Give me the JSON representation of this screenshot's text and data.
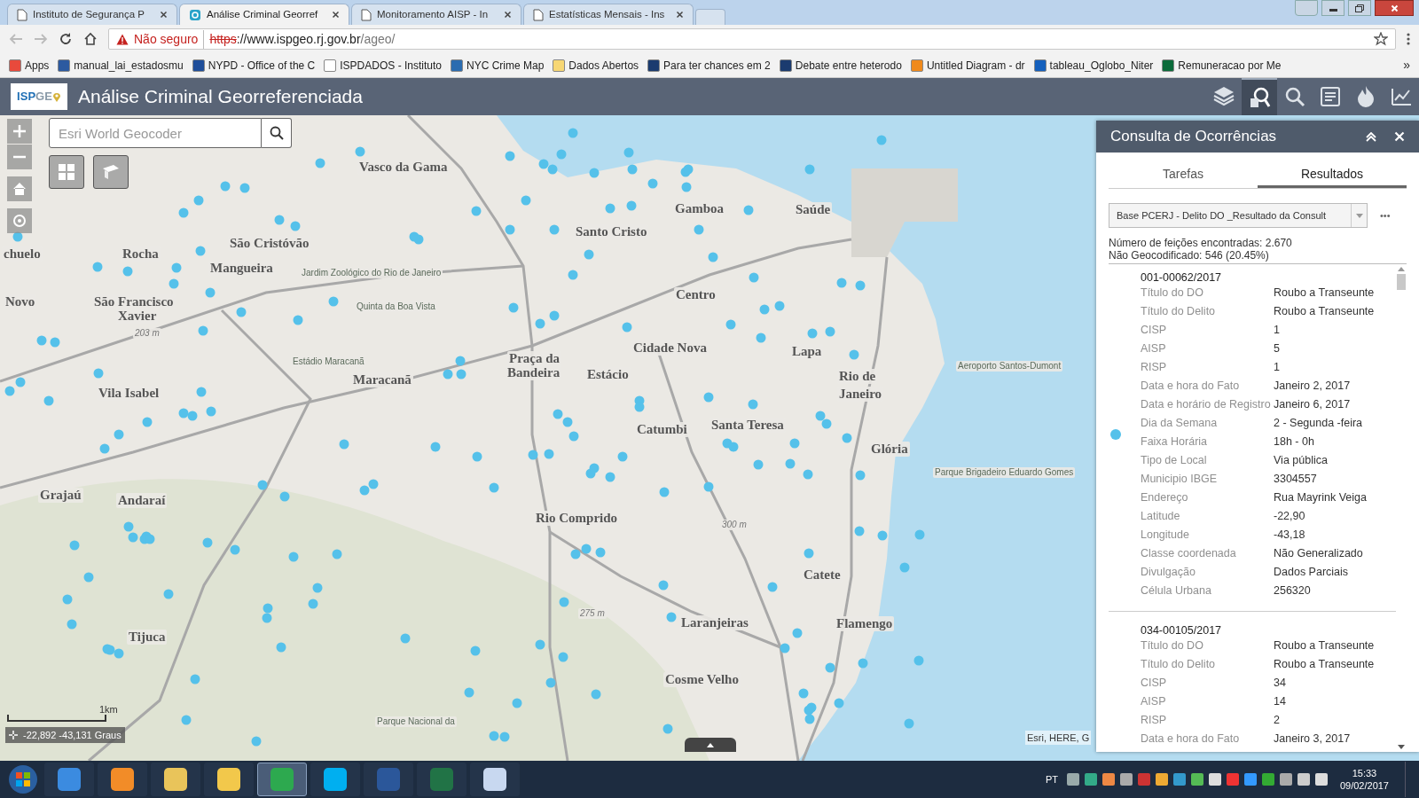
{
  "browser": {
    "tabs": [
      {
        "label": "Instituto de Segurança P",
        "selected": false
      },
      {
        "label": "Análise Criminal Georref",
        "selected": true
      },
      {
        "label": "Monitoramento AISP - In",
        "selected": false
      },
      {
        "label": "Estatísticas Mensais - Ins",
        "selected": false
      }
    ],
    "address": {
      "security": "Não seguro",
      "scheme": "https",
      "host": "://www.ispgeo.rj.gov.br",
      "path": "/ageo/"
    },
    "bookmarks": [
      "Apps",
      "manual_lai_estadosmu",
      "NYPD - Office of the C",
      "ISPDADOS - Instituto",
      "NYC Crime Map",
      "Dados Abertos",
      "Para ter chances em 2",
      "Debate entre heterodo",
      "Untitled Diagram - dr",
      "tableau_Oglobo_Niter",
      "Remuneracao por Me"
    ],
    "overflow": "»"
  },
  "app": {
    "logo": [
      "ISP",
      "GE"
    ],
    "title": "Análise Criminal Georreferenciada",
    "tools": [
      {
        "kind": "layers",
        "selected": false
      },
      {
        "kind": "query",
        "selected": true
      },
      {
        "kind": "search",
        "selected": false
      },
      {
        "kind": "list",
        "selected": false
      },
      {
        "kind": "fire",
        "selected": false
      },
      {
        "kind": "chart",
        "selected": false
      }
    ]
  },
  "map": {
    "search": {
      "placeholder": "Esri World Geocoder"
    },
    "labels": [
      {
        "kind": "district",
        "text": "Vasco da Gama"
      },
      {
        "kind": "district",
        "text": "Gamboa"
      },
      {
        "kind": "district",
        "text": "Saúde"
      },
      {
        "kind": "district",
        "text": "Santo Cristo"
      },
      {
        "kind": "district",
        "text": "São Cristóvão"
      },
      {
        "kind": "district",
        "text": "Rocha"
      },
      {
        "kind": "district",
        "text": "chuelo"
      },
      {
        "kind": "district",
        "text": "Mangueira"
      },
      {
        "kind": "poi",
        "text": "Jardim Zoológico do Rio de Janeiro"
      },
      {
        "kind": "district",
        "text": "Centro"
      },
      {
        "kind": "district",
        "text": "Novo"
      },
      {
        "kind": "district",
        "text": "São Francisco"
      },
      {
        "kind": "poi",
        "text": "Quinta da Boa Vista"
      },
      {
        "kind": "district",
        "text": "Xavier"
      },
      {
        "kind": "elevation",
        "text": "203 m"
      },
      {
        "kind": "district",
        "text": "Cidade Nova"
      },
      {
        "kind": "district",
        "text": "Lapa"
      },
      {
        "kind": "poi",
        "text": "Estádio Maracanã"
      },
      {
        "kind": "district",
        "text": "Praça da"
      },
      {
        "kind": "poi",
        "text": "Aeroporto Santos-Dumont"
      },
      {
        "kind": "district",
        "text": "Bandeira"
      },
      {
        "kind": "district",
        "text": "Estácio"
      },
      {
        "kind": "district",
        "text": "Rio de"
      },
      {
        "kind": "district",
        "text": "Maracanã"
      },
      {
        "kind": "district",
        "text": "Vila Isabel"
      },
      {
        "kind": "district",
        "text": "Janeiro"
      },
      {
        "kind": "district",
        "text": "Santa Teresa"
      },
      {
        "kind": "district",
        "text": "Catumbi"
      },
      {
        "kind": "district",
        "text": "Glória"
      },
      {
        "kind": "poi",
        "text": "Parque Brigadeiro Eduardo Gomes"
      },
      {
        "kind": "district",
        "text": "Grajaú"
      },
      {
        "kind": "district",
        "text": "Andaraí"
      },
      {
        "kind": "district",
        "text": "Rio Comprido"
      },
      {
        "kind": "elevation",
        "text": "300 m"
      },
      {
        "kind": "district",
        "text": "Catete"
      },
      {
        "kind": "elevation",
        "text": "275 m"
      },
      {
        "kind": "district",
        "text": "Laranjeiras"
      },
      {
        "kind": "district",
        "text": "Flamengo"
      },
      {
        "kind": "district",
        "text": "Tijuca"
      },
      {
        "kind": "district",
        "text": "Cosme Velho"
      },
      {
        "kind": "poi",
        "text": "Parque Nacional da"
      }
    ],
    "scale": "1km",
    "coordinates": "-22,892 -43,131 Graus",
    "attribution": "Esri, HERE, G"
  },
  "panel": {
    "title": "Consulta de Ocorrências",
    "tabs": [
      {
        "label": "Tarefas",
        "selected": false
      },
      {
        "label": "Resultados",
        "selected": true
      }
    ],
    "layer": "Base PCERJ - Delito DO _Resultado da Consult",
    "more": "•••",
    "summary": [
      "Número de feições encontradas: 2.670",
      "Não Geocodificado: 546 (20.45%)"
    ],
    "records": [
      {
        "id": "001-00062/2017",
        "fields": [
          [
            "Título do DO",
            "Roubo a Transeunte"
          ],
          [
            "Título do Delito",
            "Roubo a Transeunte"
          ],
          [
            "CISP",
            "1"
          ],
          [
            "AISP",
            "5"
          ],
          [
            "RISP",
            "1"
          ],
          [
            "Data e hora do Fato",
            "Janeiro 2, 2017"
          ],
          [
            "Data e horário de Registro",
            "Janeiro 6, 2017"
          ],
          [
            "Dia da Semana",
            "2 - Segunda -feira"
          ],
          [
            "Faixa Horária",
            "18h - 0h"
          ],
          [
            "Tipo de Local",
            "Via pública"
          ],
          [
            "Municipio IBGE",
            "3304557"
          ],
          [
            "Endereço",
            "Rua Mayrink Veiga"
          ],
          [
            "Latitude",
            "-22,90"
          ],
          [
            "Longitude",
            "-43,18"
          ],
          [
            "Classe coordenada",
            "Não Generalizado"
          ],
          [
            "Divulgação",
            "Dados Parciais"
          ],
          [
            "Célula Urbana",
            "256320"
          ]
        ]
      },
      {
        "id": "034-00105/2017",
        "fields": [
          [
            "Título do DO",
            "Roubo a Transeunte"
          ],
          [
            "Título do Delito",
            "Roubo a Transeunte"
          ],
          [
            "CISP",
            "34"
          ],
          [
            "AISP",
            "14"
          ],
          [
            "RISP",
            "2"
          ],
          [
            "Data e hora do Fato",
            "Janeiro 3, 2017"
          ]
        ]
      }
    ]
  },
  "taskbar": {
    "apps": [
      {
        "kind": "ie",
        "selected": false
      },
      {
        "kind": "media",
        "selected": false
      },
      {
        "kind": "folder",
        "selected": false
      },
      {
        "kind": "mail",
        "selected": false
      },
      {
        "kind": "chrome",
        "selected": true
      },
      {
        "kind": "skype",
        "selected": false
      },
      {
        "kind": "word",
        "selected": false
      },
      {
        "kind": "excel",
        "selected": false
      },
      {
        "kind": "paint",
        "selected": false
      }
    ],
    "language": "PT",
    "time": "15:33",
    "date": "09/02/2017"
  }
}
